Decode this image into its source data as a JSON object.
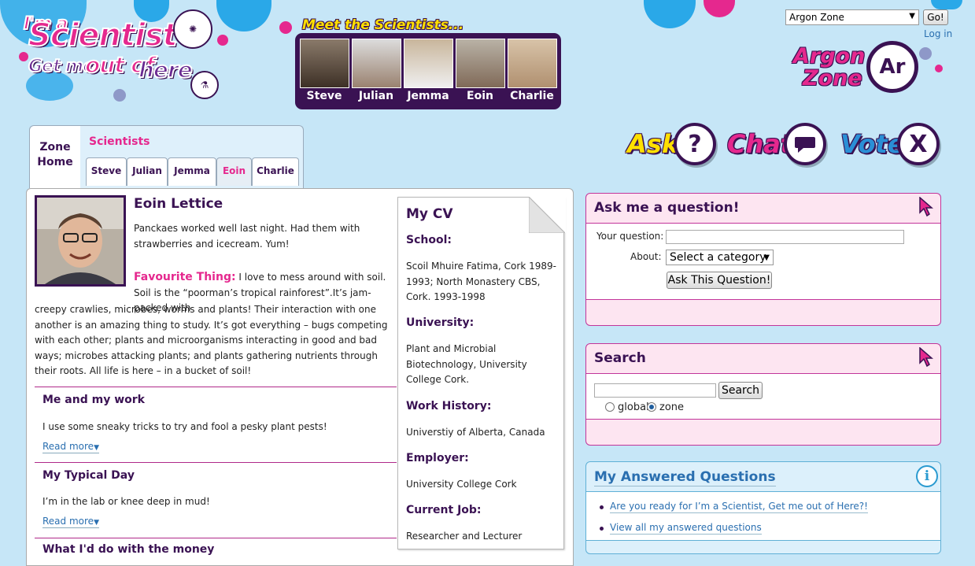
{
  "header": {
    "logo": {
      "line1": "I'm a",
      "line2": "Scientist",
      "line3": "Get me",
      "line4": "out of",
      "line5": "here"
    },
    "meet_title": "Meet the Scientists...",
    "scientists": [
      "Steve",
      "Julian",
      "Jemma",
      "Eoin",
      "Charlie"
    ],
    "zone_select": "Argon Zone",
    "go_label": "Go!",
    "login_label": "Log in",
    "zone_logo": {
      "line1": "Argon",
      "line2": "Zone",
      "symbol": "Ar"
    },
    "actions": [
      {
        "label": "Ask",
        "icon_glyph": "?",
        "color": "#ffe000"
      },
      {
        "label": "Chat",
        "icon_glyph": "",
        "color": "#e5288e"
      },
      {
        "label": "Vote",
        "icon_glyph": "X",
        "color": "#2a8fd6"
      }
    ]
  },
  "tabs": {
    "zone_home": "Zone Home",
    "scientists_label": "Scientists",
    "items": [
      "Steve",
      "Julian",
      "Jemma",
      "Eoin",
      "Charlie"
    ],
    "active": "Eoin"
  },
  "profile": {
    "name": "Eoin Lettice",
    "status": "Panckaes worked well last night. Had them with strawberries and icecream. Yum!",
    "favourite_label": "Favourite Thing:",
    "favourite_lead": "I love to mess around with soil. Soil is the “poorman’s tropical rainforest”.It’s jam-packed with",
    "favourite_rest": "creepy crawlies, microbes, worms and plants! Their interaction with one another is an amazing thing to study. It’s got everything – bugs competing with each other; plants and microorganisms interacting in good and bad ways; microbes attacking plants; and plants gathering nutrients through their roots. All life is here – in a bucket of soil!",
    "sections": [
      {
        "title": "Me and my work",
        "text": "I use some sneaky tricks to try and fool a pesky plant pests!",
        "more": "Read more"
      },
      {
        "title": "My Typical Day",
        "text": "I’m in the lab or knee deep in mud!",
        "more": "Read more"
      },
      {
        "title": "What I'd do with the money"
      }
    ]
  },
  "cv": {
    "title": "My CV",
    "school_label": "School:",
    "school": "Scoil Mhuire Fatima, Cork 1989-1993; North Monastery CBS, Cork. 1993-1998",
    "university_label": "University:",
    "university": "Plant and Microbial Biotechnology, University College Cork.",
    "work_label": "Work History:",
    "work": "Universtiy of Alberta, Canada",
    "employer_label": "Employer:",
    "employer": "University College Cork",
    "job_label": "Current Job:",
    "job": "Researcher and Lecturer"
  },
  "ask": {
    "title": "Ask me a question!",
    "question_label": "Your question:",
    "question_value": "",
    "about_label": "About:",
    "category_value": "Select a category",
    "submit_label": "Ask This Question!"
  },
  "search": {
    "title": "Search",
    "query": "",
    "button_label": "Search",
    "scope_global": "global",
    "scope_zone": "zone",
    "selected_scope": "zone"
  },
  "answered": {
    "title": "My Answered Questions",
    "links": [
      "Are you ready for I’m a Scientist, Get me out of Here?!",
      "View all my answered questions"
    ]
  },
  "colors": {
    "brand_pink": "#e5288e",
    "brand_purple": "#3a1253",
    "link_blue": "#2a6fb0",
    "sky": "#c6e6f7"
  }
}
